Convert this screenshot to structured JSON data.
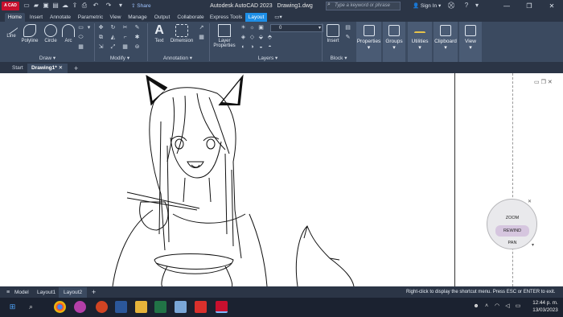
{
  "titlebar": {
    "logo": "A CAD",
    "share": "Share",
    "app_title": "Autodesk AutoCAD 2023",
    "doc_title": "Drawing1.dwg",
    "search_placeholder": "Type a keyword or phrase",
    "signin": "Sign In"
  },
  "tabs": [
    "Home",
    "Insert",
    "Annotate",
    "Parametric",
    "View",
    "Manage",
    "Output",
    "Collaborate",
    "Express Tools",
    "Layout"
  ],
  "ribbon": {
    "draw": {
      "line": "Line",
      "polyline": "Polyline",
      "circle": "Circle",
      "arc": "Arc",
      "title": "Draw ▾"
    },
    "modify": {
      "title": "Modify ▾"
    },
    "annotation": {
      "text": "Text",
      "dimension": "Dimension",
      "title": "Annotation ▾"
    },
    "layers": {
      "layer_properties_1": "Layer",
      "layer_properties_2": "Properties",
      "current": "0",
      "title": "Layers ▾"
    },
    "block": {
      "insert": "Insert",
      "title": "Block ▾"
    },
    "properties": "Properties",
    "groups": "Groups",
    "utilities": "Utilities",
    "clipboard": "Clipboard",
    "view": "View"
  },
  "doctabs": {
    "start": "Start",
    "drawing": "Drawing1*",
    "add": "+"
  },
  "navwheel": {
    "zoom": "ZOOM",
    "rewind": "REWIND",
    "pan": "PAN"
  },
  "statusbar": {
    "model": "Model",
    "layout1": "Layout1",
    "layout2": "Layout2",
    "add": "+",
    "message": "Right-click to display the shortcut menu. Press ESC or ENTER to exit."
  },
  "taskbar": {
    "time": "12:44 p. m.",
    "date": "13/03/2023"
  },
  "colors": {
    "accent": "#1d8ee6",
    "ribbon": "#3b4a60",
    "titlebar": "#2b3546",
    "autocad_red": "#c8102e"
  }
}
